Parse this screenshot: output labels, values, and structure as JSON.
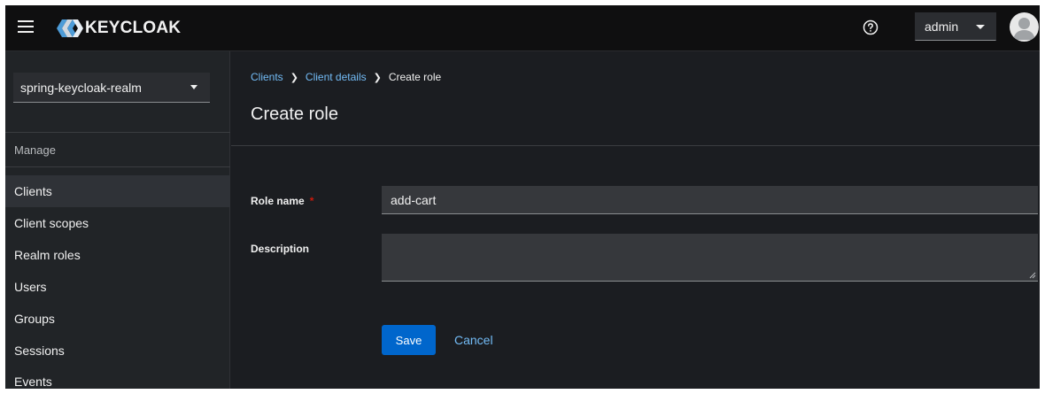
{
  "masthead": {
    "brand": "KEYCLOAK",
    "user": "admin"
  },
  "sidebar": {
    "realm": "spring-keycloak-realm",
    "section_title": "Manage",
    "items": [
      {
        "label": "Clients"
      },
      {
        "label": "Client scopes"
      },
      {
        "label": "Realm roles"
      },
      {
        "label": "Users"
      },
      {
        "label": "Groups"
      },
      {
        "label": "Sessions"
      },
      {
        "label": "Events"
      }
    ]
  },
  "breadcrumb": {
    "items": [
      "Clients",
      "Client details",
      "Create role"
    ]
  },
  "page": {
    "title": "Create role"
  },
  "form": {
    "role_name_label": "Role name",
    "required_mark": "*",
    "role_name_value": "add-cart",
    "description_label": "Description",
    "description_value": ""
  },
  "actions": {
    "save": "Save",
    "cancel": "Cancel"
  },
  "colors": {
    "accent": "#0066cc",
    "link": "#73bcf7",
    "required": "#c9190b"
  }
}
